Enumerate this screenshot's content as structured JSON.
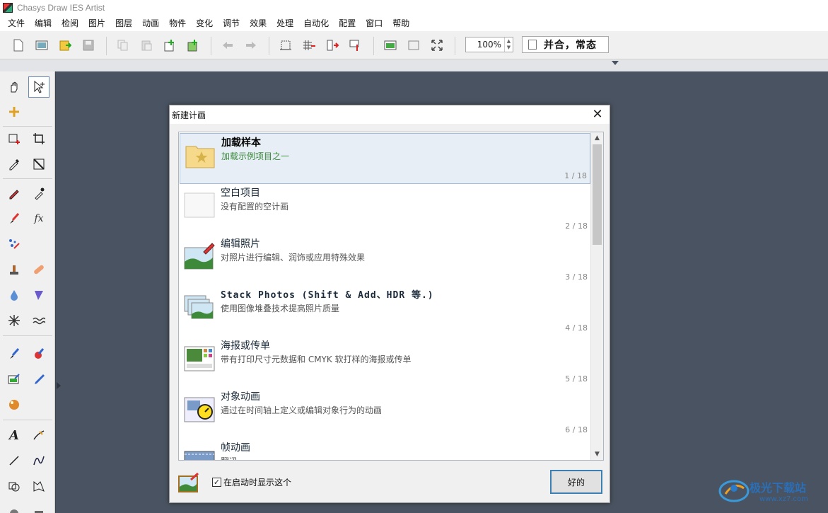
{
  "window": {
    "title": "Chasys Draw IES Artist"
  },
  "menu": [
    "文件",
    "编辑",
    "检阅",
    "图片",
    "图层",
    "动画",
    "物件",
    "变化",
    "调节",
    "效果",
    "处理",
    "自动化",
    "配置",
    "窗口",
    "帮助"
  ],
  "toolbar": {
    "zoom": "100%",
    "blend_mode": "并合，常态",
    "icons": [
      "new-document-icon",
      "open-icon",
      "import-icon",
      "save-icon",
      "copy-icon",
      "paste-icon",
      "add-layer-icon",
      "duplicate-layer-icon",
      "undo-icon",
      "redo-icon",
      "crop-canvas-icon",
      "grid-icon",
      "flip-icon",
      "resize-icon",
      "view-image-icon",
      "view-frame-icon",
      "fullscreen-icon"
    ]
  },
  "toolbox": {
    "tools": [
      "hand-tool-icon",
      "select-tool-icon",
      "move-tool-icon",
      "rect-select-icon",
      "crop-tool-icon",
      "eyedropper-icon",
      "transform-icon",
      "pencil-icon",
      "dropper-icon",
      "brush-icon",
      "fx-brush-icon",
      "scatter-icon",
      "stamp-icon",
      "bandage-icon",
      "water-drop-icon",
      "cone-icon",
      "spark-icon",
      "wave-icon",
      "paint-brush-icon",
      "fill-brush-icon",
      "image-edit-icon",
      "marker-icon",
      "sphere-icon",
      "text-tool-icon",
      "pen-tool-icon",
      "line-tool-icon",
      "curve-tool-icon",
      "shape-tool-icon",
      "warp-tool-icon"
    ]
  },
  "dialog": {
    "title": "新建计画",
    "items": [
      {
        "name": "加载样本",
        "desc": "加载示例项目之一",
        "index": "1 / 18",
        "selected": true
      },
      {
        "name": "空白项目",
        "desc": "没有配置的空计画",
        "index": "2 / 18"
      },
      {
        "name": "编辑照片",
        "desc": "对照片进行编辑、润饰或应用特殊效果",
        "index": "3 / 18"
      },
      {
        "name": "Stack Photos (Shift & Add、HDR 等.)",
        "desc": "使用图像堆叠技术提高照片质量",
        "index": "4 / 18"
      },
      {
        "name": "海报或传单",
        "desc": "带有打印尺寸元数据和 CMYK 软打样的海报或传单",
        "index": "5 / 18"
      },
      {
        "name": "对象动画",
        "desc": "通过在时间轴上定义或编辑对象行为的动画",
        "index": "6 / 18"
      },
      {
        "name": "帧动画",
        "desc": "翻迅"
      }
    ],
    "scroll_fraction": 0.0,
    "show_on_startup_label": "在启动时显示这个",
    "show_on_startup_checked": true,
    "ok_label": "好的",
    "close_glyph": "✕"
  },
  "watermark": {
    "text": "极光下载站",
    "url": "www.xz7.com"
  }
}
